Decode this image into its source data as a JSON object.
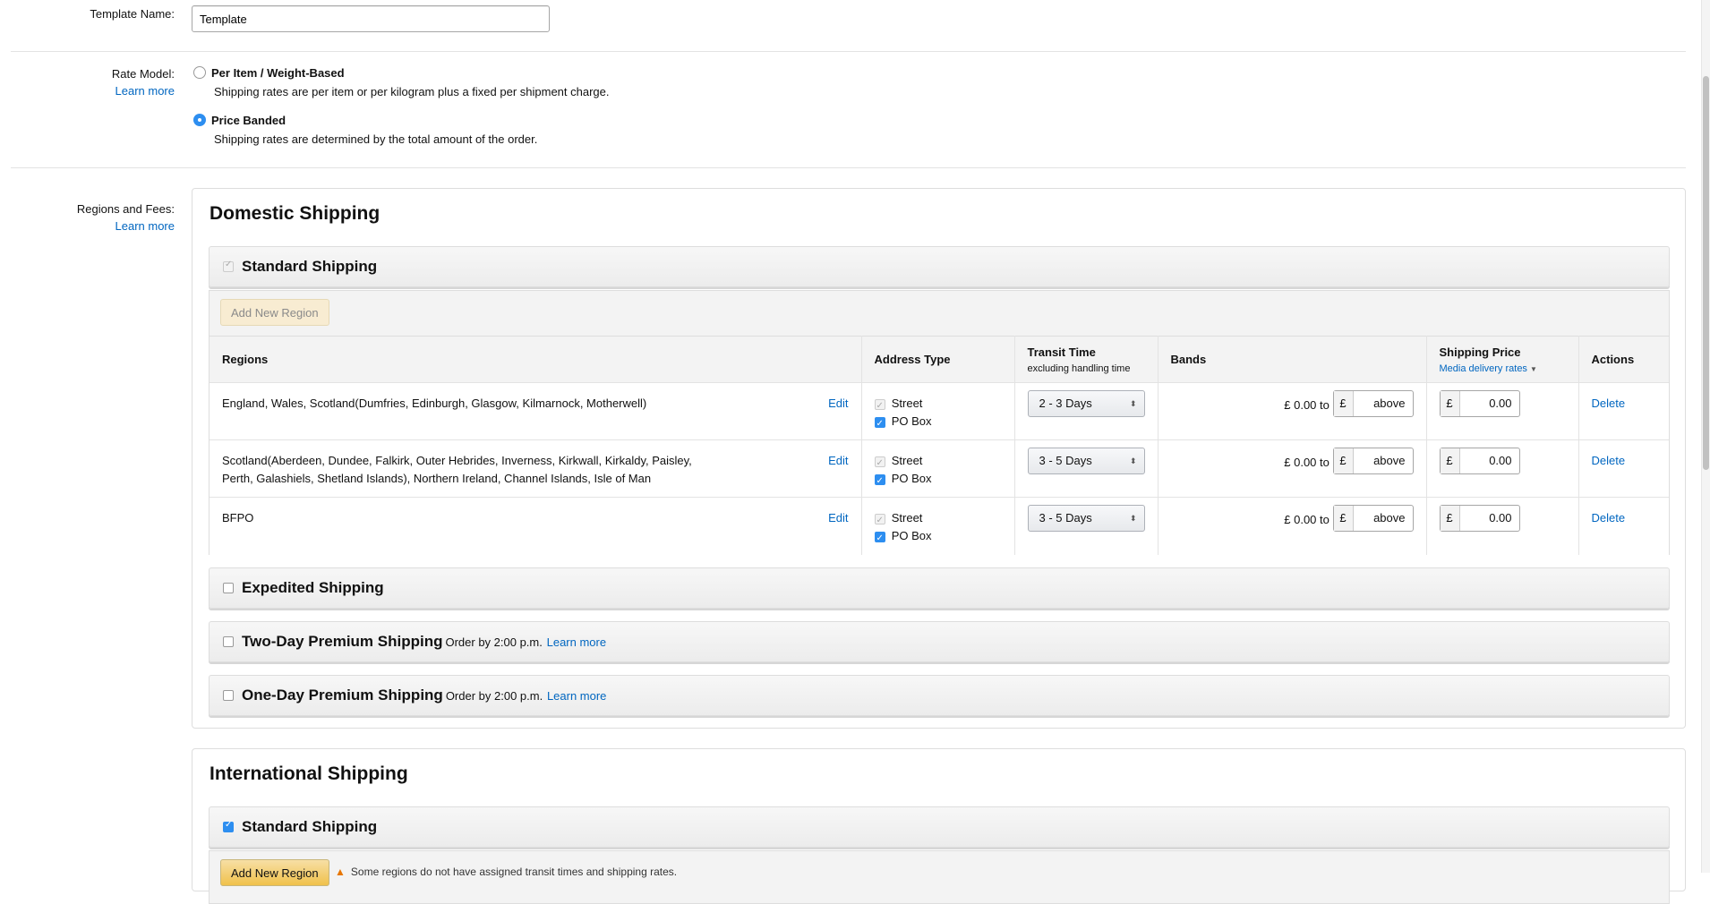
{
  "template_name": {
    "label": "Template Name:",
    "value": "Template"
  },
  "rate_model": {
    "label": "Rate Model:",
    "learn_more": "Learn more",
    "options": [
      {
        "title": "Per Item / Weight-Based",
        "desc": "Shipping rates are per item or per kilogram plus a fixed per shipment charge.",
        "selected": false
      },
      {
        "title": "Price Banded",
        "desc": "Shipping rates are determined by the total amount of the order.",
        "selected": true
      }
    ]
  },
  "regions_fees": {
    "label": "Regions and Fees:",
    "learn_more": "Learn more"
  },
  "domestic": {
    "title": "Domestic Shipping",
    "standard": {
      "label": "Standard Shipping",
      "checked": true,
      "add_region": "Add New Region",
      "headers": {
        "regions": "Regions",
        "address": "Address Type",
        "transit": "Transit Time",
        "transit_sub": "excluding handling time",
        "bands": "Bands",
        "price": "Shipping Price",
        "price_link": "Media delivery rates",
        "actions": "Actions"
      },
      "rows": [
        {
          "region": "England, Wales, Scotland(Dumfries, Edinburgh, Glasgow, Kilmarnock, Motherwell)",
          "edit": "Edit",
          "street": "Street",
          "pobox": "PO Box",
          "transit": "2 - 3 Days",
          "band_from": "£ 0.00 to",
          "band_cur": "£",
          "band_to": "above",
          "price_cur": "£",
          "price": "0.00",
          "delete": "Delete"
        },
        {
          "region": "Scotland(Aberdeen, Dundee, Falkirk, Outer Hebrides, Inverness, Kirkwall, Kirkaldy, Paisley, Perth, Galashiels, Shetland Islands), Northern Ireland, Channel Islands, Isle of Man",
          "edit": "Edit",
          "street": "Street",
          "pobox": "PO Box",
          "transit": "3 - 5 Days",
          "band_from": "£ 0.00 to",
          "band_cur": "£",
          "band_to": "above",
          "price_cur": "£",
          "price": "0.00",
          "delete": "Delete"
        },
        {
          "region": "BFPO",
          "edit": "Edit",
          "street": "Street",
          "pobox": "PO Box",
          "transit": "3 - 5 Days",
          "band_from": "£ 0.00 to",
          "band_cur": "£",
          "band_to": "above",
          "price_cur": "£",
          "price": "0.00",
          "delete": "Delete"
        }
      ]
    },
    "expedited": {
      "label": "Expedited Shipping",
      "checked": false
    },
    "two_day": {
      "label": "Two-Day Premium Shipping",
      "note": "Order by 2:00 p.m.",
      "learn_more": "Learn more",
      "checked": false
    },
    "one_day": {
      "label": "One-Day Premium Shipping",
      "note": "Order by 2:00 p.m.",
      "learn_more": "Learn more",
      "checked": false
    }
  },
  "international": {
    "title": "International Shipping",
    "standard": {
      "label": "Standard Shipping",
      "checked": true,
      "add_region": "Add New Region",
      "warning": "Some regions do not have assigned transit times and shipping rates."
    }
  }
}
